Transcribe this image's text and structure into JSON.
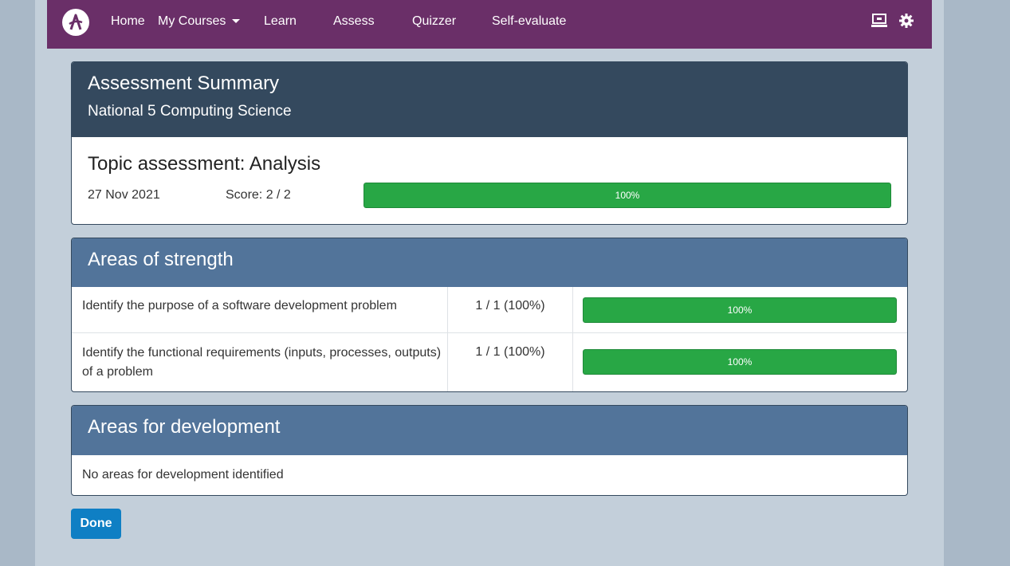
{
  "nav": {
    "items": [
      "Home",
      "My Courses",
      "Learn",
      "Assess",
      "Quizzer",
      "Self-evaluate"
    ],
    "brand_color": "#6a2f68"
  },
  "summary": {
    "title": "Assessment Summary",
    "course": "National 5 Computing Science",
    "topic": "Topic assessment: Analysis",
    "date": "27 Nov 2021",
    "score": "Score: 2 / 2",
    "progress_label": "100%",
    "progress_value": 1.0
  },
  "strengths": {
    "title": "Areas of strength",
    "rows": [
      {
        "text": "Identify the purpose of a software development problem",
        "score": "1 / 1 (100%)",
        "bar_label": "100%",
        "bar_value": 1.0
      },
      {
        "text": "Identify the functional requirements (inputs, processes, outputs) of a problem",
        "score": "1 / 1 (100%)",
        "bar_label": "100%",
        "bar_value": 1.0
      }
    ]
  },
  "development": {
    "title": "Areas for development",
    "empty_text": "No areas for development identified"
  },
  "done_label": "Done",
  "colors": {
    "success": "#28a745",
    "header_dark": "#34495e",
    "header_blue": "#52749a",
    "button": "#0f7fc4"
  }
}
